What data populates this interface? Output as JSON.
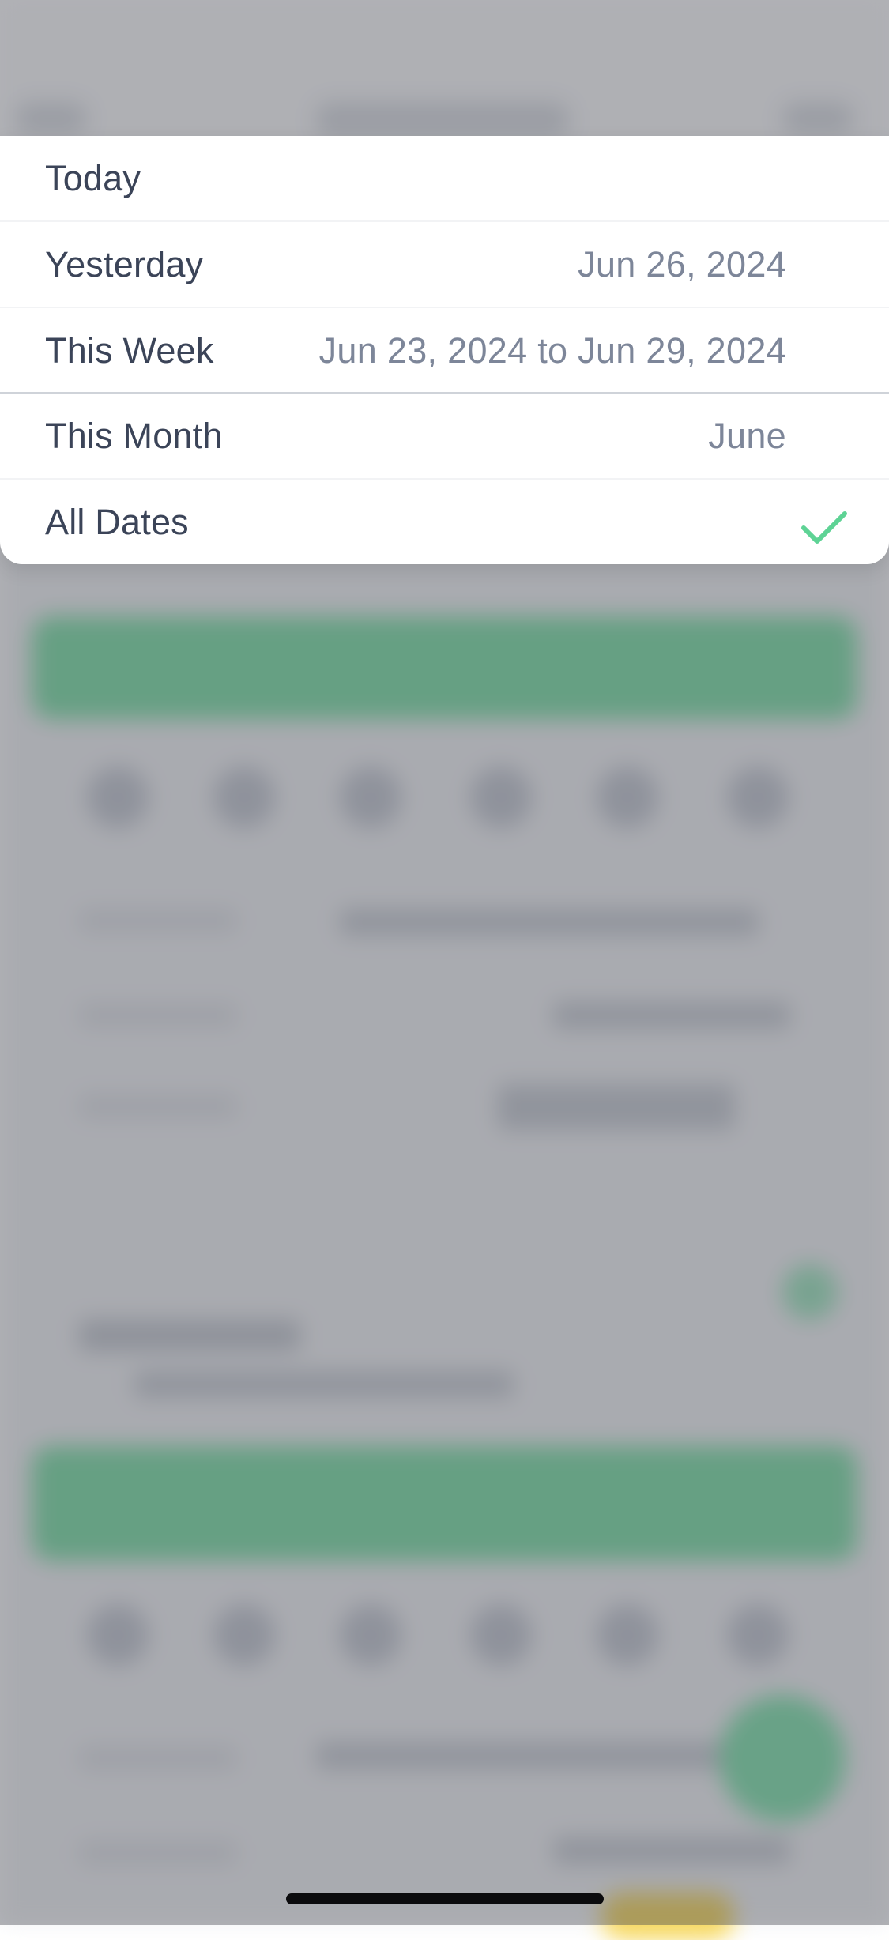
{
  "date_filter": {
    "options": [
      {
        "label": "Today",
        "value": "",
        "selected": false
      },
      {
        "label": "Yesterday",
        "value": "Jun 26, 2024",
        "selected": false
      },
      {
        "label": "This Week",
        "value": "Jun 23, 2024 to Jun 29, 2024",
        "selected": false
      },
      {
        "label": "This Month",
        "value": "June",
        "selected": false
      },
      {
        "label": "All Dates",
        "value": "",
        "selected": true
      }
    ],
    "selected_icon": "checkmark-icon"
  },
  "colors": {
    "accent_green": "#5ed395",
    "label_text": "#3b4458",
    "value_text": "#7d8699",
    "overlay": "#6a6c73"
  }
}
